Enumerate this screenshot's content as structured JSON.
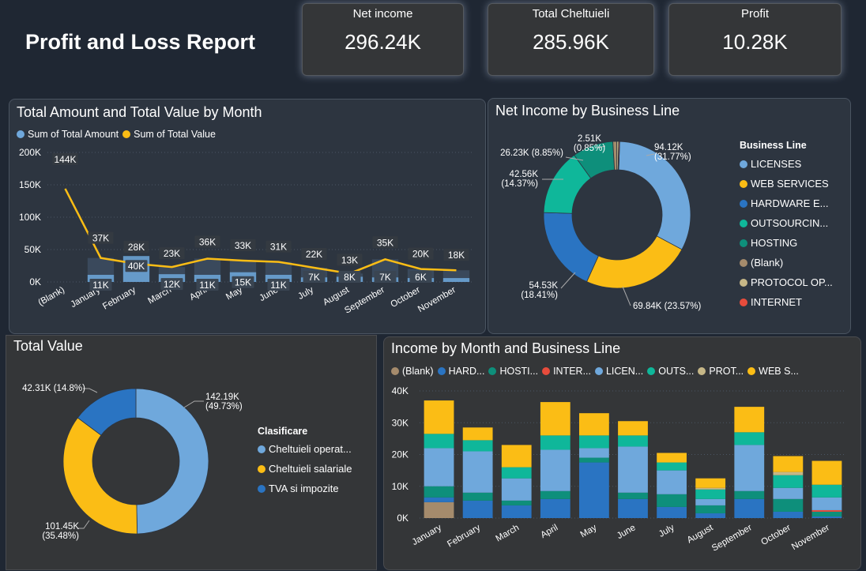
{
  "report_title": "Profit and Loss Report",
  "kpis": [
    {
      "label": "Net income",
      "value": "296.24K"
    },
    {
      "label": "Total Cheltuieli",
      "value": "285.96K"
    },
    {
      "label": "Profit",
      "value": "10.28K"
    }
  ],
  "colors": {
    "blue_light": "#6fa8dc",
    "dark_blue": "#2a74c2",
    "yellow": "#fbbd15",
    "teal": "#0fb79a",
    "dark_teal": "#0e8f7b",
    "tan": "#a58b6c",
    "khaki": "#c6b787",
    "red": "#e74c3c",
    "grid": "#4a5563"
  },
  "chart_data": [
    {
      "id": "amount_value",
      "type": "bar",
      "title": "Total Amount and Total Value by Month",
      "categories": [
        "(Blank)",
        "January",
        "February",
        "March",
        "April",
        "May",
        "June",
        "July",
        "August",
        "September",
        "October",
        "November"
      ],
      "series": [
        {
          "name": "Sum of Total Amount",
          "type": "bar",
          "values": [
            0,
            11000,
            40000,
            12000,
            11000,
            15000,
            11000,
            7000,
            8000,
            7000,
            6000,
            0
          ],
          "labels": [
            "",
            "11K",
            "40K",
            "12K",
            "11K",
            "15K",
            "11K",
            "7K",
            "8K",
            "7K",
            "6K",
            ""
          ]
        },
        {
          "name": "Sum of Total Value",
          "type": "line",
          "values": [
            144000,
            37000,
            28000,
            23000,
            36000,
            33000,
            31000,
            22000,
            13000,
            35000,
            20000,
            18000
          ],
          "labels": [
            "144K",
            "37K",
            "28K",
            "23K",
            "36K",
            "33K",
            "31K",
            "22K",
            "13K",
            "35K",
            "20K",
            "18K"
          ]
        }
      ],
      "yticks": [
        "0K",
        "50K",
        "100K",
        "150K",
        "200K"
      ],
      "ylim": [
        0,
        200000
      ],
      "legend": "top-left"
    },
    {
      "id": "net_income_bl",
      "type": "pie",
      "title": "Net Income by Business Line",
      "legend_title": "Business Line",
      "slices": [
        {
          "name": "LICENSES",
          "value": 94.12,
          "label": "94.12K (31.77%)"
        },
        {
          "name": "WEB SERVICES",
          "value": 69.84,
          "label": "69.84K (23.57%)"
        },
        {
          "name": "HARDWARE E...",
          "value": 54.53,
          "label": "54.53K (18.41%)"
        },
        {
          "name": "OUTSOURCIN...",
          "value": 42.56,
          "label": "42.56K (14.37%)"
        },
        {
          "name": "HOSTING",
          "value": 26.23,
          "label": "26.23K (8.85%)"
        },
        {
          "name": "(Blank)",
          "value": 2.51,
          "label": "2.51K (0.85%)"
        },
        {
          "name": "PROTOCOL OP...",
          "value": 1.2,
          "label": ""
        },
        {
          "name": "INTERNET",
          "value": 0.6,
          "label": ""
        }
      ]
    },
    {
      "id": "total_value",
      "type": "pie",
      "title": "Total Value",
      "legend_title": "Clasificare",
      "slices": [
        {
          "name": "Cheltuieli operat...",
          "value": 142.19,
          "label": "142.19K (49.73%)"
        },
        {
          "name": "Cheltuieli salariale",
          "value": 101.45,
          "label": "101.45K (35.48%)"
        },
        {
          "name": "TVA si impozite",
          "value": 42.31,
          "label": "42.31K (14.8%)"
        }
      ]
    },
    {
      "id": "income_month_bl",
      "type": "bar",
      "title": "Income by Month and Business Line",
      "stacked": true,
      "categories": [
        "January",
        "February",
        "March",
        "April",
        "May",
        "June",
        "July",
        "August",
        "September",
        "October",
        "November"
      ],
      "legend": [
        "(Blank)",
        "HARD...",
        "HOSTI...",
        "INTER...",
        "LICEN...",
        "OUTS...",
        "PROT...",
        "WEB S..."
      ],
      "series": [
        {
          "name": "(Blank)",
          "values": [
            5000,
            0,
            0,
            0,
            0,
            0,
            0,
            0,
            0,
            0,
            0
          ]
        },
        {
          "name": "HARDWARE",
          "values": [
            1500,
            5500,
            4000,
            6000,
            17500,
            6000,
            3500,
            1500,
            6000,
            2000,
            500
          ]
        },
        {
          "name": "HOSTING",
          "values": [
            3500,
            2500,
            1500,
            2500,
            1500,
            2000,
            4000,
            2500,
            2500,
            4000,
            1500
          ]
        },
        {
          "name": "INTERNET",
          "values": [
            0,
            0,
            0,
            0,
            0,
            0,
            0,
            0,
            0,
            0,
            500
          ]
        },
        {
          "name": "LICENSES",
          "values": [
            12000,
            13000,
            7000,
            13000,
            3000,
            14500,
            7500,
            2000,
            14500,
            3500,
            4000
          ]
        },
        {
          "name": "OUTSOURCING",
          "values": [
            4500,
            3500,
            3500,
            4500,
            4000,
            3500,
            2500,
            3000,
            4000,
            4000,
            4000
          ]
        },
        {
          "name": "PROTOCOL",
          "values": [
            0,
            0,
            0,
            0,
            0,
            0,
            0,
            500,
            0,
            1000,
            0
          ]
        },
        {
          "name": "WEB SERVICES",
          "values": [
            10500,
            4000,
            7000,
            10500,
            7000,
            4500,
            3000,
            3000,
            8000,
            5000,
            7500
          ]
        }
      ],
      "yticks": [
        "0K",
        "10K",
        "20K",
        "30K",
        "40K"
      ],
      "ylim": [
        0,
        40000
      ]
    }
  ]
}
